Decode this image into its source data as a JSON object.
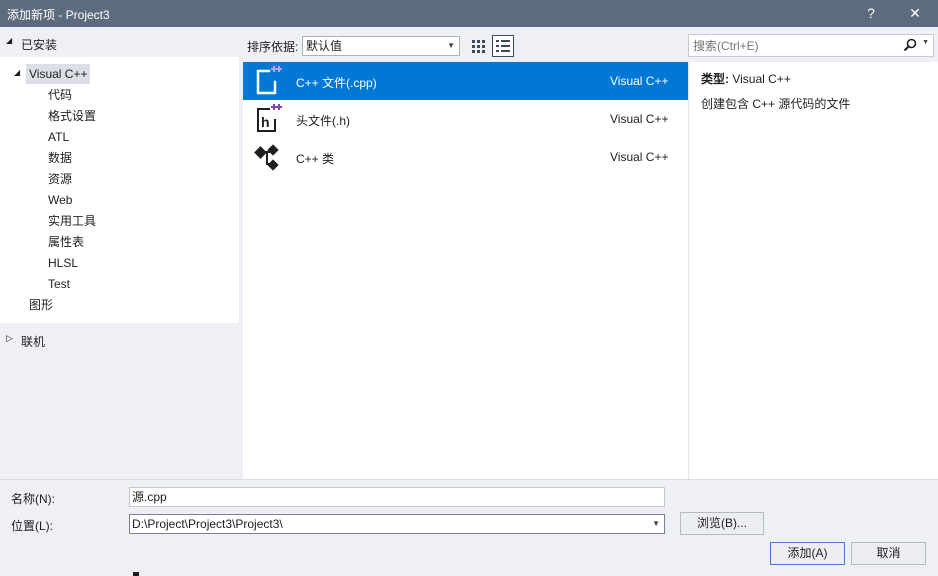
{
  "window": {
    "title": "添加新项 - Project3",
    "help_label": "?",
    "close_label": "✕"
  },
  "left": {
    "installed_label": "已安装",
    "tree_root": "Visual C++",
    "tree_children": [
      "代码",
      "格式设置",
      "ATL",
      "数据",
      "资源",
      "Web",
      "实用工具",
      "属性表",
      "HLSL",
      "Test"
    ],
    "graphics_label": "图形",
    "online_label": "联机"
  },
  "sort": {
    "label": "排序依据:",
    "value": "默认值"
  },
  "search": {
    "placeholder": "搜索(Ctrl+E)"
  },
  "templates": [
    {
      "name": "C++ 文件(.cpp)",
      "lang": "Visual C++",
      "icon": "cpp-file-icon",
      "selected": true
    },
    {
      "name": "头文件(.h)",
      "lang": "Visual C++",
      "icon": "header-file-icon",
      "selected": false
    },
    {
      "name": "C++ 类",
      "lang": "Visual C++",
      "icon": "cpp-class-icon",
      "selected": false
    }
  ],
  "detail": {
    "type_label": "类型:",
    "type_value": "Visual C++",
    "description": "创建包含 C++ 源代码的文件"
  },
  "form": {
    "name_label": "名称(N):",
    "name_value": "源.cpp",
    "location_label": "位置(L):",
    "location_value": "D:\\Project\\Project3\\Project3\\",
    "browse_label": "浏览(B)...",
    "add_label": "添加(A)",
    "cancel_label": "取消"
  },
  "colors": {
    "titlebar": "#5c6b7e",
    "selection": "#0078d4",
    "accent_purple": "#8a3db6"
  }
}
